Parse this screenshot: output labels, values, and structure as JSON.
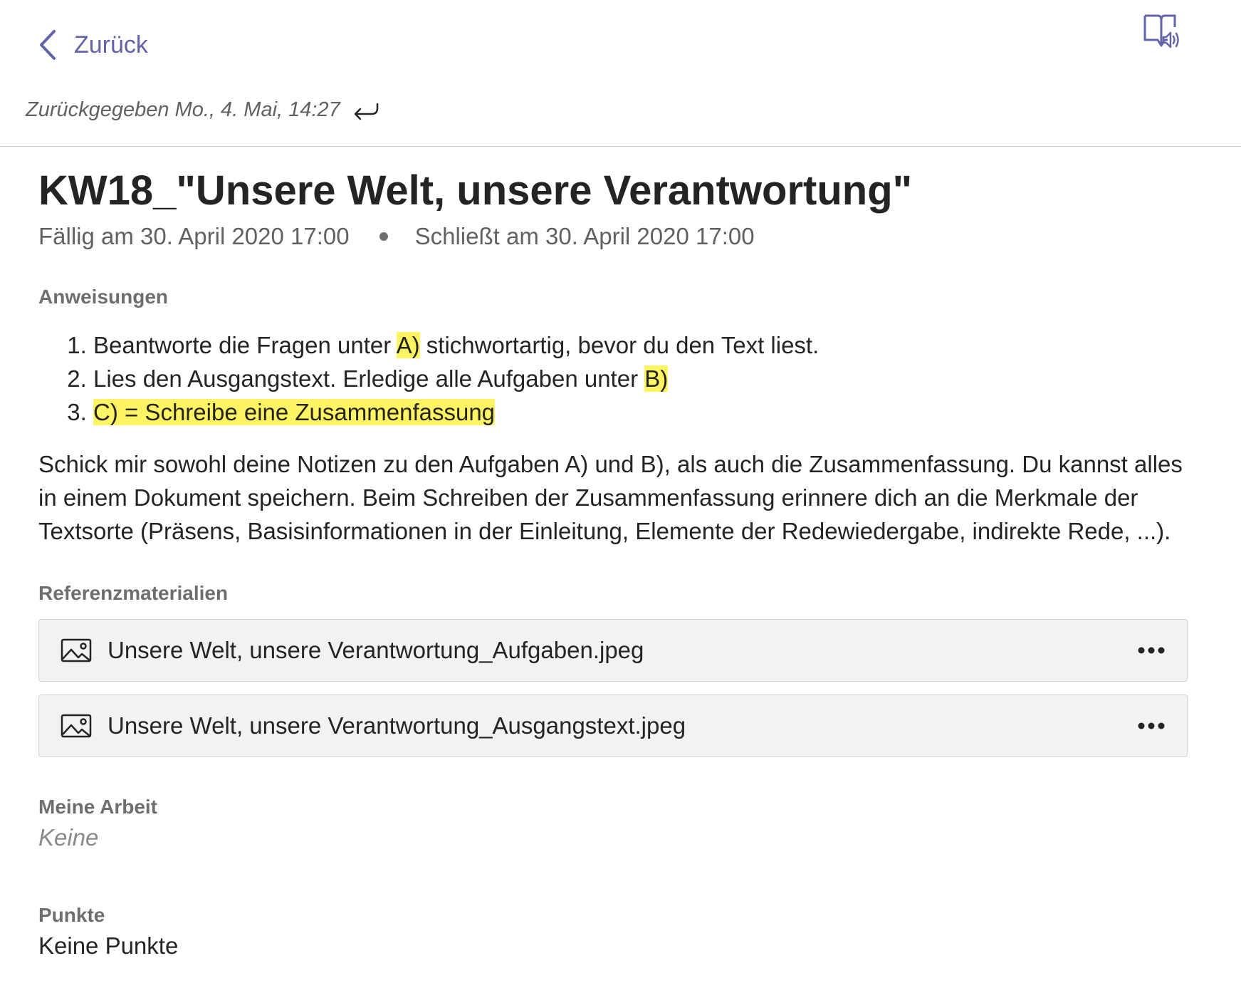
{
  "header": {
    "back_label": "Zurück",
    "returned_text": "Zurückgegeben Mo., 4. Mai, 14:27"
  },
  "assignment": {
    "title": "KW18_\"Unsere Welt, unsere Verantwortung\"",
    "due": "Fällig am 30. April 2020 17:00",
    "closes": "Schließt am 30. April 2020 17:00"
  },
  "instructions": {
    "label": "Anweisungen",
    "steps": [
      {
        "before": "Beantworte die Fragen unter ",
        "highlight": "A)",
        "after": " stichwortartig, bevor du den Text liest."
      },
      {
        "before": "Lies den Ausgangstext. Erledige alle Aufgaben unter ",
        "highlight": "B)",
        "after": ""
      },
      {
        "before": "",
        "highlight": "C) = Schreibe eine Zusammenfassung",
        "after": ""
      }
    ],
    "paragraph": "Schick mir sowohl deine Notizen zu den Aufgaben A) und B), als auch die Zusammenfassung. Du kannst alles in einem Dokument speichern. Beim Schreiben der Zusammenfassung erinnere dich an die Merkmale der Textsorte (Präsens, Basisinformationen in der Einleitung, Elemente der Redewiedergabe, indirekte Rede, ...)."
  },
  "references": {
    "label": "Referenzmaterialien",
    "files": [
      {
        "name": "Unsere Welt, unsere Verantwortung_Aufgaben.jpeg",
        "icon": "image-icon"
      },
      {
        "name": "Unsere Welt, unsere Verantwortung_Ausgangstext.jpeg",
        "icon": "image-icon"
      }
    ]
  },
  "my_work": {
    "label": "Meine Arbeit",
    "value": "Keine"
  },
  "points": {
    "label": "Punkte",
    "value": "Keine Punkte"
  },
  "colors": {
    "accent": "#6264a7",
    "highlight": "#fff463",
    "file_bg": "#f3f2f1"
  }
}
